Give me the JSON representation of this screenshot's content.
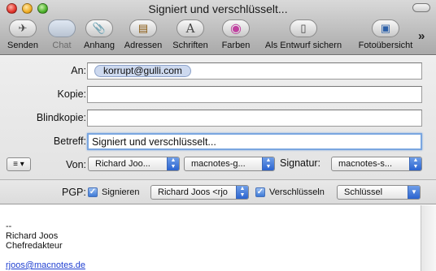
{
  "window": {
    "title": "Signiert und verschlüsselt..."
  },
  "toolbar": {
    "items": [
      {
        "label": "Senden",
        "icon": "send-icon",
        "glyph": "✈"
      },
      {
        "label": "Chat",
        "icon": "chat-icon",
        "glyph": ""
      },
      {
        "label": "Anhang",
        "icon": "paperclip-icon",
        "glyph": "📎"
      },
      {
        "label": "Adressen",
        "icon": "address-book-icon",
        "glyph": "▤"
      },
      {
        "label": "Schriften",
        "icon": "fonts-icon",
        "glyph": "A"
      },
      {
        "label": "Farben",
        "icon": "colors-icon",
        "glyph": "◉"
      },
      {
        "label": "Als Entwurf sichern",
        "icon": "save-draft-icon",
        "glyph": "▯"
      },
      {
        "label": "Fotoübersicht",
        "icon": "photo-browser-icon",
        "glyph": "▣"
      }
    ],
    "overflow": "»"
  },
  "headers": {
    "to": {
      "label": "An:",
      "recipient": "korrupt@gulli.com"
    },
    "cc": {
      "label": "Kopie:",
      "value": ""
    },
    "bcc": {
      "label": "Blindkopie:",
      "value": ""
    },
    "subject": {
      "label": "Betreff:",
      "value": "Signiert und verschlüsselt..."
    },
    "from": {
      "menu": "≡ ▾",
      "label": "Von:",
      "account": "Richard Joo...",
      "server": "macnotes-g...",
      "signature_label": "Signatur:",
      "signature": "macnotes-s..."
    }
  },
  "pgp": {
    "label": "PGP:",
    "sign": {
      "label": "Signieren",
      "checked": true
    },
    "key": "Richard Joos <rjo",
    "encrypt": {
      "label": "Verschlüsseln",
      "checked": true
    },
    "encrypt_key": "Schlüssel"
  },
  "body": {
    "lines": [
      "--",
      "Richard Joos",
      "Chefredakteur"
    ],
    "link": "rjoos@macnotes.de"
  },
  "colors": {
    "accent": "#2a63cf",
    "link": "#1f3fd1",
    "token": "#cdd9ef"
  }
}
